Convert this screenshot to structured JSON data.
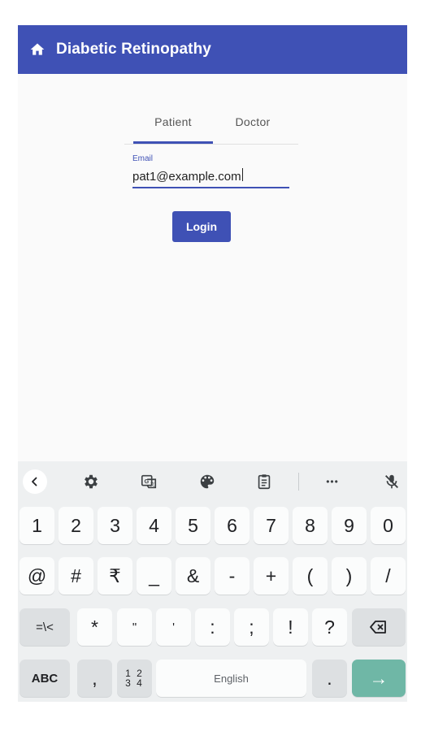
{
  "app": {
    "title": "Diabetic Retinopathy"
  },
  "tabs": [
    {
      "label": "Patient",
      "selected": true
    },
    {
      "label": "Doctor",
      "selected": false
    }
  ],
  "email_field": {
    "label": "Email",
    "value": "pat1@example.com"
  },
  "login_button": {
    "label": "Login"
  },
  "keyboard": {
    "toolbar_icons": [
      "back-icon",
      "settings-icon",
      "translate-icon",
      "palette-icon",
      "clipboard-icon",
      "more-icon",
      "mic-off-icon"
    ],
    "more_label": "•••",
    "row1": [
      "1",
      "2",
      "3",
      "4",
      "5",
      "6",
      "7",
      "8",
      "9",
      "0"
    ],
    "row2": [
      "@",
      "#",
      "₹",
      "_",
      "&",
      "-",
      "+",
      "(",
      ")",
      "/"
    ],
    "row3": {
      "shift_label": "=\\<",
      "keys": [
        "*",
        "\"",
        "'",
        ":",
        ";",
        "!",
        "?"
      ]
    },
    "row4": {
      "abc_label": "ABC",
      "comma": ",",
      "numbers_top": "1 2",
      "numbers_bottom": "3 4",
      "space_label": "English",
      "period": ".",
      "enter_label": "→"
    },
    "colors": {
      "accent": "#3f51b5",
      "enter": "#6fb7a6",
      "keyboard_bg": "#eef0f1"
    }
  }
}
